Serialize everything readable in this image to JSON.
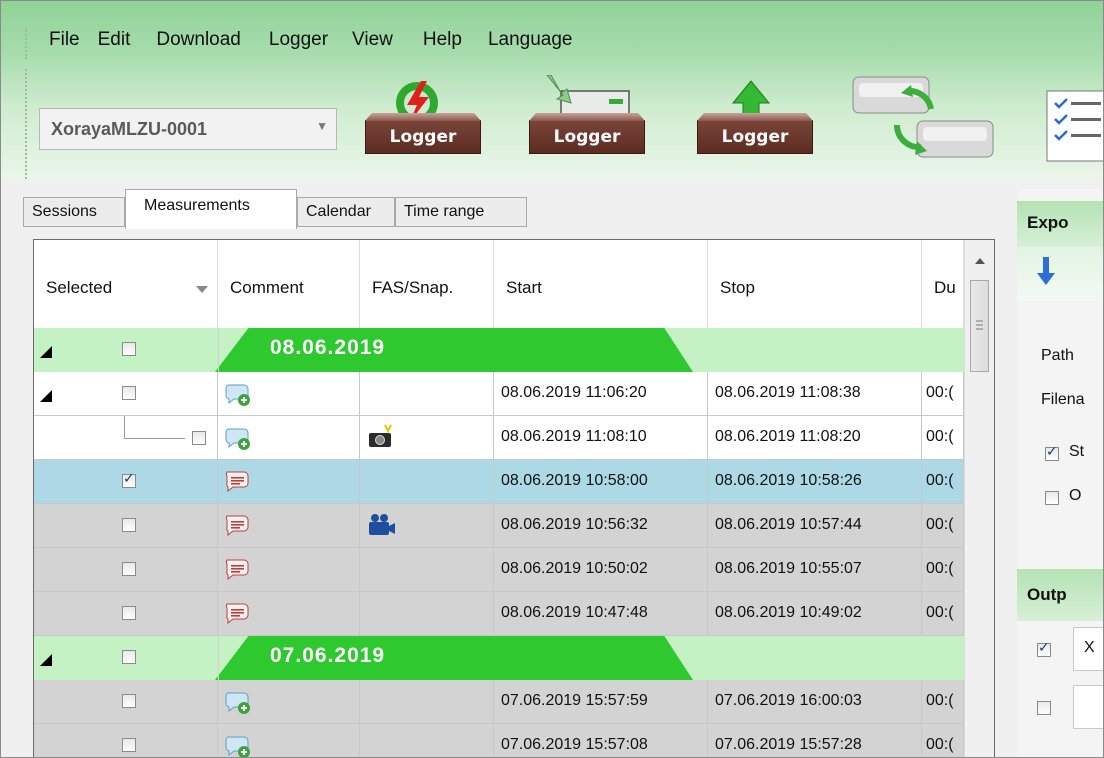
{
  "menu": [
    "File",
    "Edit",
    "Download",
    "Logger",
    "View",
    "Help",
    "Language"
  ],
  "device_combo": {
    "value": "XorayaMLZU-0001"
  },
  "toolbar": {
    "logger_label": "Logger"
  },
  "tabs": [
    {
      "label": "Sessions",
      "active": false
    },
    {
      "label": "Measurements",
      "active": true
    },
    {
      "label": "Calendar",
      "active": false
    },
    {
      "label": "Time range",
      "active": false
    }
  ],
  "grid": {
    "columns": [
      "Selected",
      "Comment",
      "FAS/Snap.",
      "Start",
      "Stop",
      "Du"
    ],
    "groups": [
      {
        "date": "08.06.2019",
        "rows": [
          {
            "checked": false,
            "comment_icon": "comment-add-icon",
            "snap_icon": "",
            "start": "08.06.2019 11:06:20",
            "stop": "08.06.2019 11:08:38",
            "duration": "00:(",
            "expander": true,
            "style": "white"
          },
          {
            "checked": false,
            "comment_icon": "comment-add-icon",
            "snap_icon": "camera-icon",
            "start": "08.06.2019 11:08:10",
            "stop": "08.06.2019 11:08:20",
            "duration": "00:(",
            "child": true,
            "style": "white"
          },
          {
            "checked": true,
            "comment_icon": "comment-text-icon",
            "snap_icon": "",
            "start": "08.06.2019 10:58:00",
            "stop": "08.06.2019 10:58:26",
            "duration": "00:(",
            "style": "selected"
          },
          {
            "checked": false,
            "comment_icon": "comment-text-icon",
            "snap_icon": "video-camera-icon",
            "start": "08.06.2019 10:56:32",
            "stop": "08.06.2019 10:57:44",
            "duration": "00:(",
            "style": "gray"
          },
          {
            "checked": false,
            "comment_icon": "comment-text-icon",
            "snap_icon": "",
            "start": "08.06.2019 10:50:02",
            "stop": "08.06.2019 10:55:07",
            "duration": "00:(",
            "style": "gray"
          },
          {
            "checked": false,
            "comment_icon": "comment-text-icon",
            "snap_icon": "",
            "start": "08.06.2019 10:47:48",
            "stop": "08.06.2019 10:49:02",
            "duration": "00:(",
            "style": "gray"
          }
        ]
      },
      {
        "date": "07.06.2019",
        "rows": [
          {
            "checked": false,
            "comment_icon": "comment-add-icon",
            "snap_icon": "",
            "start": "07.06.2019 15:57:59",
            "stop": "07.06.2019 16:00:03",
            "duration": "00:(",
            "style": "gray"
          },
          {
            "checked": false,
            "comment_icon": "comment-add-icon",
            "snap_icon": "",
            "start": "07.06.2019 15:57:08",
            "stop": "07.06.2019 15:57:28",
            "duration": "00:(",
            "style": "gray"
          }
        ]
      }
    ]
  },
  "right_panel": {
    "export_title": "Expo",
    "path_label": "Path",
    "filename_label": "Filena",
    "opt1_label": "St",
    "opt1_checked": true,
    "opt2_label": "O",
    "opt2_checked": false,
    "output_title": "Outp",
    "out1_checked": true,
    "out1_value": "X",
    "out2_checked": false
  },
  "colors": {
    "selected_row": "#add8e6",
    "gray_row": "#d3d3d3",
    "group_tab": "#2ec92e",
    "group_row": "#c4f2c4"
  }
}
